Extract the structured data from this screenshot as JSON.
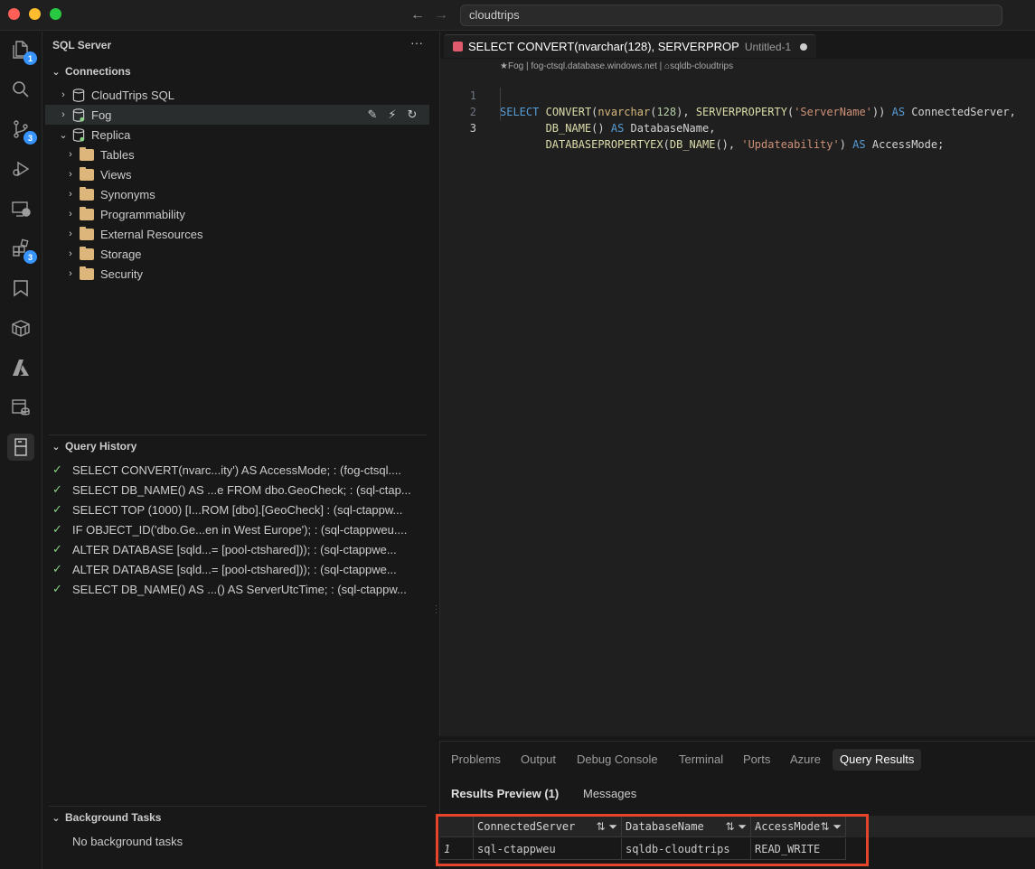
{
  "titlebar": {
    "search_text": "cloudtrips"
  },
  "activity": {
    "explorer_badge": "1",
    "scm_badge": "3",
    "extensions_badge": "3"
  },
  "sidebar": {
    "title": "SQL Server",
    "connections_label": "Connections",
    "connections": [
      {
        "label": "CloudTrips SQL"
      },
      {
        "label": "Fog"
      },
      {
        "label": "Replica"
      }
    ],
    "replica_children": [
      "Tables",
      "Views",
      "Synonyms",
      "Programmability",
      "External Resources",
      "Storage",
      "Security"
    ],
    "query_history_label": "Query History",
    "history": [
      "SELECT CONVERT(nvarc...ity') AS AccessMode; : (fog-ctsql....",
      "SELECT DB_NAME() AS ...e FROM dbo.GeoCheck; : (sql-ctap...",
      "SELECT TOP (1000) [I...ROM [dbo].[GeoCheck] : (sql-ctappw...",
      "IF OBJECT_ID('dbo.Ge...en in West Europe'); : (sql-ctappweu....",
      "ALTER DATABASE [sqld...= [pool-ctshared])); : (sql-ctappwe...",
      "ALTER DATABASE [sqld...= [pool-ctshared])); : (sql-ctappwe...",
      "SELECT DB_NAME() AS ...() AS ServerUtcTime; : (sql-ctappw..."
    ],
    "background_tasks_label": "Background Tasks",
    "background_tasks_empty": "No background tasks"
  },
  "editor": {
    "tab_title": "SELECT CONVERT(nvarchar(128), SERVERPROP",
    "tab_subtitle": "Untitled-1",
    "breadcrumb": "★Fog | fog-ctsql.database.windows.net | ⌂sqldb-cloudtrips",
    "line_numbers": [
      "1",
      "2",
      "3"
    ],
    "lines": [
      "SELECT CONVERT(nvarchar(128), SERVERPROPERTY('ServerName')) AS ConnectedServer,",
      "       DB_NAME() AS DatabaseName,",
      "       DATABASEPROPERTYEX(DB_NAME(), 'Updateability') AS AccessMode;"
    ]
  },
  "panel": {
    "tabs": [
      "Problems",
      "Output",
      "Debug Console",
      "Terminal",
      "Ports",
      "Azure",
      "Query Results"
    ],
    "active_tab": "Query Results",
    "subtabs": [
      "Results Preview (1)",
      "Messages"
    ],
    "grid": {
      "columns": [
        "ConnectedServer",
        "DatabaseName",
        "AccessMode"
      ],
      "rows": [
        {
          "num": "1",
          "cells": [
            "sql-ctappweu",
            "sqldb-cloudtrips",
            "READ_WRITE"
          ]
        }
      ]
    }
  },
  "colors": {
    "accent": "#3794ff",
    "highlight_border": "#e4452b",
    "success_check": "#89d185",
    "folder": "#dcb67a"
  }
}
